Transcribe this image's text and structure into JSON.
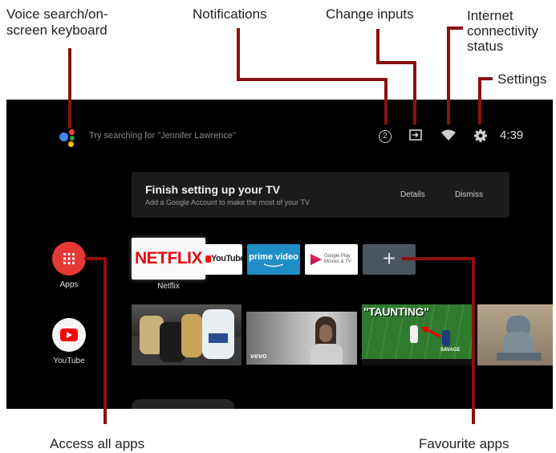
{
  "callouts": {
    "voice": "Voice search/on-screen keyboard",
    "notifications": "Notifications",
    "inputs": "Change inputs",
    "internet": "Internet connectivity status",
    "settings": "Settings",
    "access_all": "Access all apps",
    "favourites": "Favourite apps"
  },
  "screen": {
    "search_placeholder": "Try searching for \"Jennifer Lawrence\"",
    "notification_count": "2",
    "clock": "4:39",
    "setup": {
      "title": "Finish setting up your TV",
      "subtitle": "Add a Google Account to make the most of your TV",
      "details": "Details",
      "dismiss": "Dismiss"
    },
    "side_apps": [
      {
        "label": "Apps"
      },
      {
        "label": "YouTube"
      }
    ],
    "favourites": {
      "netflix": "NETFLIX",
      "netflix_label": "Netflix",
      "youtube": "YouTube",
      "prime": "prime video",
      "gplay": "Google Play Movies & TV",
      "add": "+"
    },
    "thumbs": {
      "vevo": "vevo",
      "taunting": "\"TAUNTING\"",
      "savage": "SAVAGE"
    }
  },
  "colors": {
    "accent": "#8b1010",
    "netflix": "#e50914",
    "prime": "#1f8ec6",
    "apps_red": "#e53935"
  }
}
